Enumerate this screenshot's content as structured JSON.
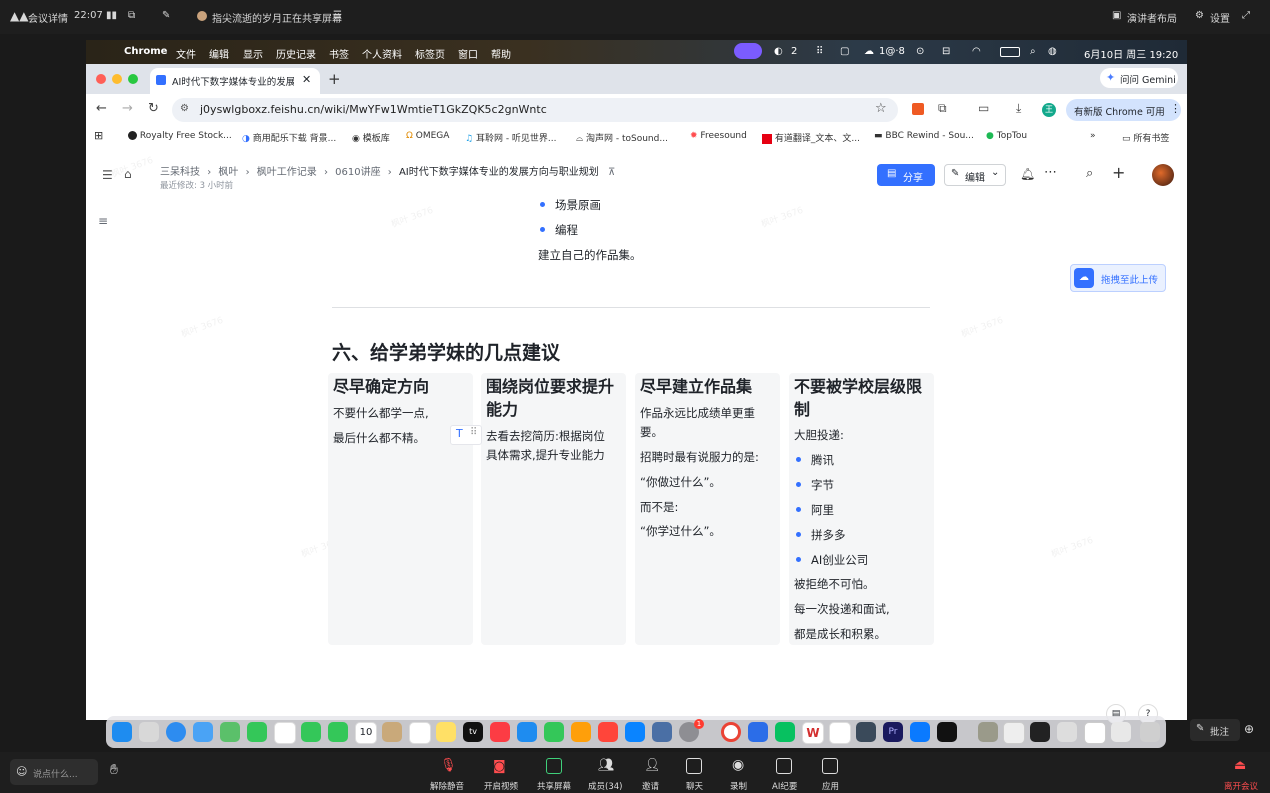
{
  "meeting": {
    "top": {
      "details": "会议详情",
      "time": "22:07",
      "sharing": "指尖流逝的岁月正在共享屏幕",
      "presenter_layout": "演讲者布局",
      "settings": "设置"
    },
    "bottom": {
      "chat_placeholder": "说点什么...",
      "unmute": "解除静音",
      "start_video": "开启视频",
      "share_screen": "共享屏幕",
      "members": "成员(34)",
      "invite": "邀请",
      "chat": "聊天",
      "record": "录制",
      "ai_minutes": "AI纪要",
      "apps": "应用",
      "leave": "离开会议",
      "annotate": "批注"
    }
  },
  "mac_menu": {
    "app": "Chrome",
    "items": [
      "文件",
      "编辑",
      "显示",
      "历史记录",
      "书签",
      "个人资料",
      "标签页",
      "窗口",
      "帮助"
    ],
    "wechat_count": "2",
    "status_text": "1@·8",
    "datetime": "6月10日 周三  19:20"
  },
  "browser": {
    "tab_title": "AI时代下数字媒体专业的发展方",
    "gemini": "问问 Gemini",
    "url": "j0yswlgboxz.feishu.cn/wiki/MwYFw1WmtieT1GkZQK5c2gnWntc",
    "profile_initial": "王",
    "update_notice": "有新版 Chrome 可用",
    "bookmarks": [
      "Royalty Free Stock...",
      "商用配乐下载 背景...",
      "模板库",
      "OMEGA",
      "耳聆网 - 听见世界...",
      "淘声网 - toSound...",
      "Freesound",
      "有道翻译_文本、文...",
      "BBC Rewind - Sou...",
      "TopTou"
    ],
    "all_bookmarks": "所有书签"
  },
  "doc": {
    "breadcrumb": [
      "三呆科技",
      "枫叶",
      "枫叶工作记录",
      "0610讲座",
      "AI时代下数字媒体专业的发展方向与职业规划"
    ],
    "last_modified": "最近修改: 3 小时前",
    "share": "分享",
    "edit": "编辑",
    "upload_hint": "拖拽至此上传",
    "watermark": "枫叶 3676",
    "list_top": [
      "场景原画",
      "编程"
    ],
    "portfolio_line": "建立自己的作品集。",
    "section_title": "六、给学弟学妹的几点建议",
    "cards": [
      {
        "title": "尽早确定方向",
        "lines": [
          "不要什么都学一点,",
          "最后什么都不精。"
        ]
      },
      {
        "title_l1": "围绕岗位要求提升",
        "title_l2": "能力",
        "lines": [
          "去看去挖简历:根据岗位",
          "具体需求,提升专业能力"
        ]
      },
      {
        "title": "尽早建立作品集",
        "lines": [
          "作品永远比成绩单更重",
          "要。",
          "招聘时最有说服力的是:",
          "“你做过什么”。",
          "而不是:",
          "“你学过什么”。"
        ]
      },
      {
        "title_l1": "不要被学校层级限",
        "title_l2": "制",
        "intro": "大胆投递:",
        "bullets": [
          "腾讯",
          "字节",
          "阿里",
          "拼多多",
          "AI创业公司"
        ],
        "outro": [
          "被拒绝不可怕。",
          "每一次投递和面试,",
          "都是成长和积累。"
        ]
      }
    ]
  },
  "dock": {
    "calendar_day": "10",
    "appletv": "tv",
    "badge": "1"
  },
  "colors": {
    "accent": "#3370ff",
    "leave": "#ff4d4f",
    "text": "#1f2329"
  }
}
